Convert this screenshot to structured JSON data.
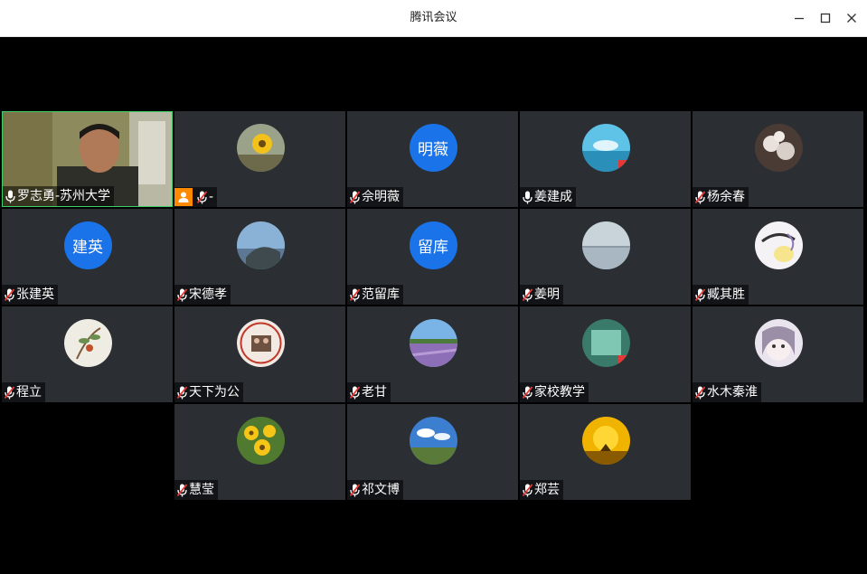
{
  "window": {
    "title": "腾讯会议"
  },
  "participants": [
    {
      "name": "罗志勇-苏州大学",
      "mic": "on",
      "avatar_type": "video",
      "avatar_text": ""
    },
    {
      "name": "-",
      "mic": "muted",
      "avatar_type": "image",
      "avatar_text": "",
      "host": true
    },
    {
      "name": "佘明薇",
      "mic": "muted",
      "avatar_type": "text",
      "avatar_text": "明薇"
    },
    {
      "name": "姜建成",
      "mic": "on",
      "avatar_type": "image",
      "avatar_text": ""
    },
    {
      "name": "杨余春",
      "mic": "muted",
      "avatar_type": "image",
      "avatar_text": ""
    },
    {
      "name": "张建英",
      "mic": "muted",
      "avatar_type": "text",
      "avatar_text": "建英"
    },
    {
      "name": "宋德孝",
      "mic": "muted",
      "avatar_type": "image",
      "avatar_text": ""
    },
    {
      "name": "范留库",
      "mic": "muted",
      "avatar_type": "text",
      "avatar_text": "留库"
    },
    {
      "name": "姜明",
      "mic": "muted",
      "avatar_type": "image",
      "avatar_text": ""
    },
    {
      "name": "臧其胜",
      "mic": "muted",
      "avatar_type": "image",
      "avatar_text": ""
    },
    {
      "name": "程立",
      "mic": "muted",
      "avatar_type": "image",
      "avatar_text": ""
    },
    {
      "name": "天下为公",
      "mic": "muted",
      "avatar_type": "image",
      "avatar_text": ""
    },
    {
      "name": "老甘",
      "mic": "muted",
      "avatar_type": "image",
      "avatar_text": ""
    },
    {
      "name": "家校教学",
      "mic": "muted",
      "avatar_type": "image",
      "avatar_text": ""
    },
    {
      "name": "水木秦淮",
      "mic": "muted",
      "avatar_type": "image",
      "avatar_text": ""
    },
    {
      "name": "慧莹",
      "mic": "muted",
      "avatar_type": "image",
      "avatar_text": ""
    },
    {
      "name": "祁文博",
      "mic": "muted",
      "avatar_type": "image",
      "avatar_text": ""
    },
    {
      "name": "郑芸",
      "mic": "muted",
      "avatar_type": "image",
      "avatar_text": ""
    }
  ],
  "colors": {
    "tile_bg": "#2b2e33",
    "text_avatar_bg": "#1a73e8",
    "host_badge": "#ff8a00",
    "active_border": "#3ecf6a",
    "muted_red": "#e53935"
  }
}
